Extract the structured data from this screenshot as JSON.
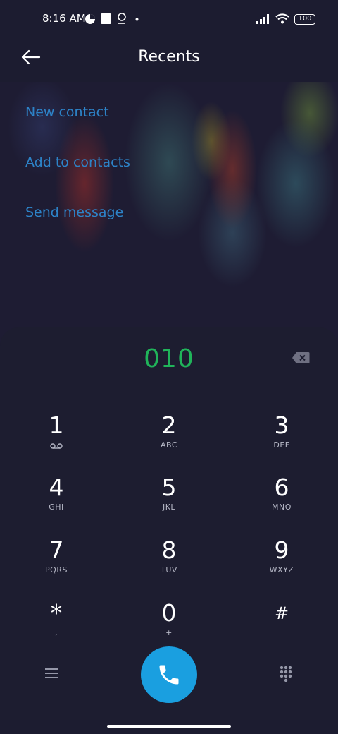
{
  "status_bar": {
    "time": "8:16 AM",
    "battery": "100",
    "icons": [
      "data-saver-icon",
      "square-notification-icon",
      "location-pin-icon",
      "dot-icon",
      "signal-icon",
      "wifi-icon",
      "battery-icon"
    ]
  },
  "header": {
    "title": "Recents",
    "back_icon": "arrow-left-icon"
  },
  "actions": [
    "New contact",
    "Add to contacts",
    "Send message"
  ],
  "dialer": {
    "number": "010",
    "keys": [
      {
        "digit": "1",
        "letters": "voicemail-icon"
      },
      {
        "digit": "2",
        "letters": "ABC"
      },
      {
        "digit": "3",
        "letters": "DEF"
      },
      {
        "digit": "4",
        "letters": "GHI"
      },
      {
        "digit": "5",
        "letters": "JKL"
      },
      {
        "digit": "6",
        "letters": "MNO"
      },
      {
        "digit": "7",
        "letters": "PQRS"
      },
      {
        "digit": "8",
        "letters": "TUV"
      },
      {
        "digit": "9",
        "letters": "WXYZ"
      },
      {
        "digit": "*",
        "letters": ","
      },
      {
        "digit": "0",
        "letters": "+"
      },
      {
        "digit": "#",
        "letters": ""
      }
    ]
  },
  "bottom_bar": {
    "menu_icon": "menu-icon",
    "call_icon": "phone-icon",
    "dialpad_icon": "dialpad-icon"
  },
  "colors": {
    "accent_blue": "#2d83c8",
    "number_green": "#20b45a",
    "call_button": "#1a9fe0",
    "panel": "#1d1d30"
  }
}
